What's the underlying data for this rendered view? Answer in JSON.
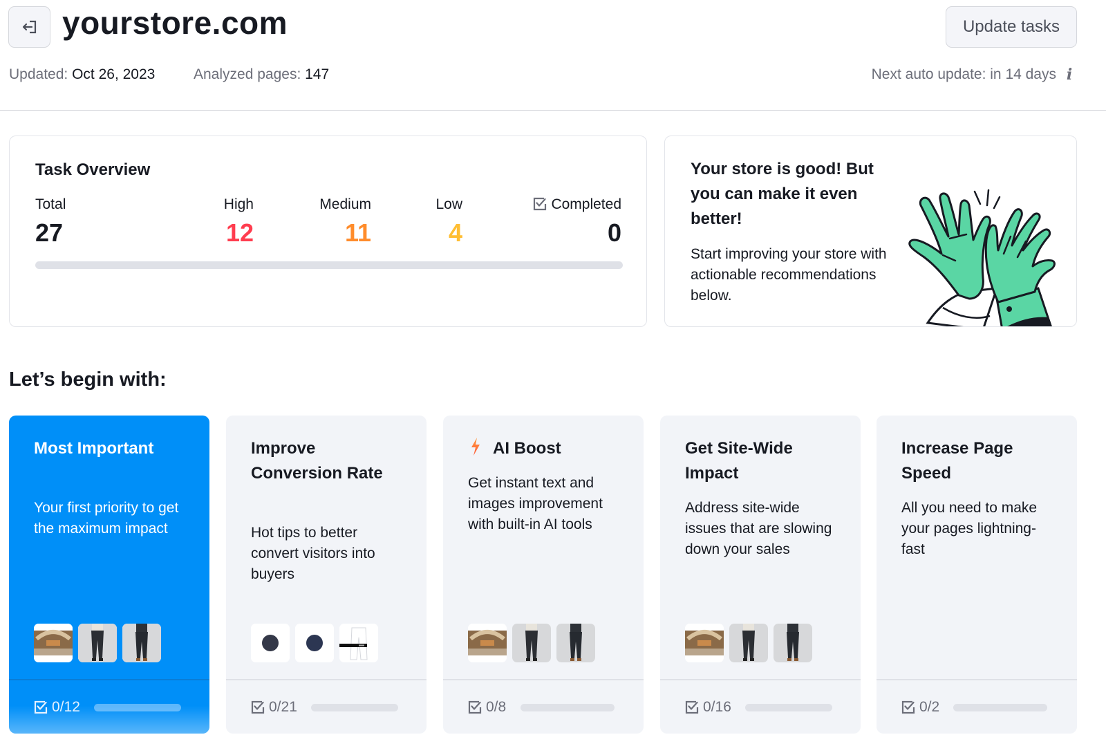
{
  "header": {
    "site_title": "yourstore.com",
    "back_icon": "exit-arrow-icon",
    "update_button_label": "Update tasks",
    "updated_label": "Updated:",
    "updated_value": "Oct 26, 2023",
    "analyzed_label": "Analyzed pages:",
    "analyzed_value": "147",
    "next_update_text": "Next auto update: in 14 days",
    "info_icon_glyph": "i"
  },
  "overview": {
    "title": "Task Overview",
    "stats": {
      "total": {
        "label": "Total",
        "value": "27"
      },
      "high": {
        "label": "High",
        "value": "12",
        "color": "#ff3d4f"
      },
      "medium": {
        "label": "Medium",
        "value": "11",
        "color": "#ff8c2b"
      },
      "low": {
        "label": "Low",
        "value": "4",
        "color": "#ffbe33"
      },
      "completed": {
        "label": "Completed",
        "value": "0",
        "icon": "checkbox-checked-icon"
      }
    },
    "progress_fraction": 0
  },
  "promo": {
    "title": "Your store is good! But you can make it even better!",
    "text": "Start improving your store with actionable recommendations below.",
    "illustration": "high-five-hands-illustration",
    "accent_color": "#5ad6a4"
  },
  "section": {
    "title": "Let’s begin with:"
  },
  "tiles": [
    {
      "title": "Most Important",
      "description": "Your first priority to get the maximum impact",
      "count": "0/12",
      "progress_fraction": 0,
      "thumbs": [
        "store-interior-thumb",
        "jeans-front-thumb",
        "jeans-model-thumb"
      ],
      "active": true
    },
    {
      "title": "Improve Conversion Rate",
      "description": "Hot tips to better convert visitors into buyers",
      "count": "0/21",
      "progress_fraction": 0,
      "thumbs": [
        "dark-circle-swatch-thumb",
        "navy-circle-swatch-thumb",
        "pants-sketch-thumb"
      ],
      "active": false
    },
    {
      "title": "AI Boost",
      "icon": "lightning-bolt-icon",
      "description": "Get instant text and images improvement with built-in AI tools",
      "count": "0/8",
      "progress_fraction": 0,
      "thumbs": [
        "store-interior-thumb",
        "jeans-front-thumb",
        "jeans-model-thumb"
      ],
      "active": false
    },
    {
      "title": "Get Site-Wide Impact",
      "description": "Address site-wide issues that are slowing down your sales",
      "count": "0/16",
      "progress_fraction": 0,
      "thumbs": [
        "store-interior-thumb",
        "jeans-front-thumb",
        "jeans-model-thumb"
      ],
      "active": false
    },
    {
      "title": "Increase Page Speed",
      "description": "All you need to make your pages lightning-fast",
      "count": "0/2",
      "progress_fraction": 0,
      "thumbs": [],
      "active": false
    }
  ],
  "colors": {
    "primary": "#008ff8",
    "tile_bg": "#f2f4f8",
    "text": "#171a22",
    "muted": "#6c6e79"
  }
}
